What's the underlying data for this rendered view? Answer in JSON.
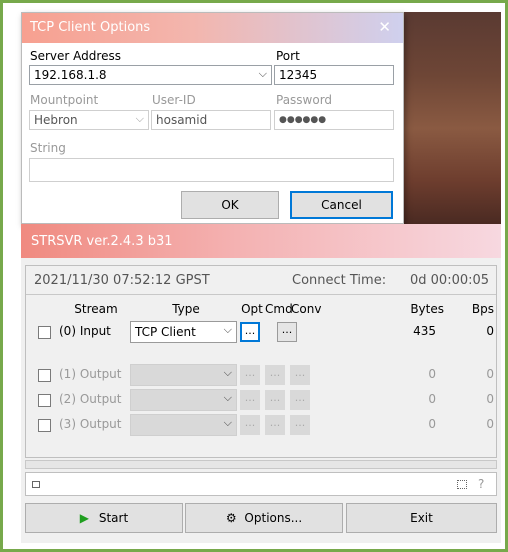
{
  "tcp_dialog": {
    "title": "TCP Client Options",
    "close_glyph": "✕",
    "server_label": "Server Address",
    "server_value": "192.168.1.8",
    "port_label": "Port",
    "port_value": "12345",
    "mountpoint_label": "Mountpoint",
    "mountpoint_value": "Hebron",
    "userid_label": "User-ID",
    "userid_value": "hosamid",
    "password_label": "Password",
    "password_value": "●●●●●●",
    "string_label": "String",
    "string_value": "",
    "ok_label": "OK",
    "cancel_label": "Cancel"
  },
  "strsvr": {
    "title": "STRSVR ver.2.4.3 b31",
    "time": "2021/11/30 07:52:12 GPST",
    "connect_label": "Connect Time:",
    "connect_value": "0d 00:00:05",
    "headers": {
      "stream": "Stream",
      "type": "Type",
      "opt": "Opt",
      "cmd": "Cmd",
      "conv": "Conv",
      "bytes": "Bytes",
      "bps": "Bps"
    },
    "rows": [
      {
        "name": "(0) Input",
        "type": "TCP Client",
        "bytes": "435",
        "bps": "0"
      },
      {
        "name": "(1) Output",
        "type": "",
        "bytes": "0",
        "bps": "0"
      },
      {
        "name": "(2) Output",
        "type": "",
        "bytes": "0",
        "bps": "0"
      },
      {
        "name": "(3) Output",
        "type": "",
        "bytes": "0",
        "bps": "0"
      }
    ],
    "ellipsis": "...",
    "help_glyph": "?",
    "start_label": "Start",
    "options_label": "Options...",
    "exit_label": "Exit"
  },
  "colors": {
    "frame": "#77a94b",
    "accent": "#0078d7",
    "start_icon": "#1f9e1f"
  }
}
